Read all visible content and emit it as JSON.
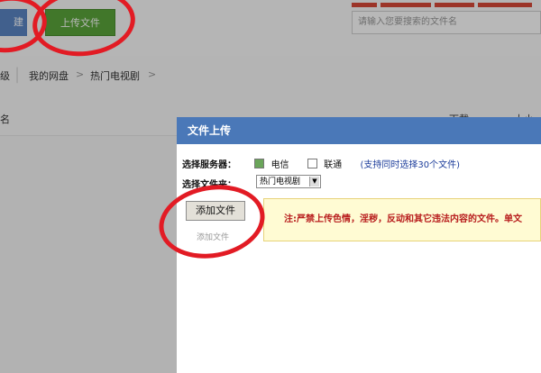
{
  "toolbar": {
    "left_button_label": "建",
    "upload_button_label": "上传文件",
    "search_placeholder": "请输入您要搜索的文件名"
  },
  "breadcrumb": {
    "up_label": "级",
    "items": [
      "我的网盘",
      "热门电视剧"
    ],
    "separator": ">"
  },
  "table_header": {
    "name": "名",
    "download": "下载",
    "size": "大小"
  },
  "upload_dialog": {
    "title": "文件上传",
    "server_label": "选择服务器：",
    "servers": [
      {
        "label": "电信",
        "checked": true
      },
      {
        "label": "联通",
        "checked": false
      }
    ],
    "server_hint": "(支持同时选择30个文件)",
    "folder_label": "选择文件夹：",
    "folder_value": "热门电视剧",
    "add_file_button": "添加文件",
    "add_file_link": "添加文件",
    "notice": "注:严禁上传色情，淫秽，反动和其它违法内容的文件。单文"
  },
  "colors": {
    "annotation_red": "#e21b24",
    "header_blue": "#4a78b8",
    "upload_green": "#5ba53b"
  }
}
